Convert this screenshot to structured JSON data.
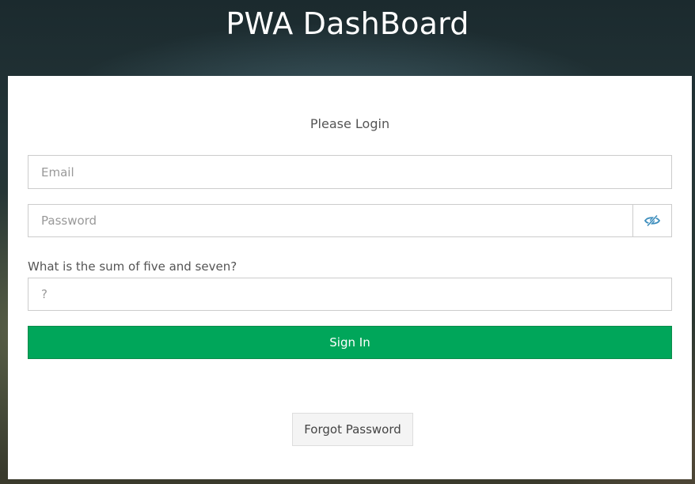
{
  "app": {
    "title": "PWA DashBoard"
  },
  "login": {
    "heading": "Please Login",
    "email": {
      "placeholder": "Email",
      "value": ""
    },
    "password": {
      "placeholder": "Password",
      "value": "",
      "toggle_icon": "eye-slash-icon"
    },
    "captcha": {
      "question": "What is the sum of five and seven?",
      "placeholder": "?",
      "value": ""
    },
    "signin_label": "Sign In",
    "forgot_label": "Forgot Password"
  },
  "colors": {
    "primary_action": "#00a65a",
    "icon_accent": "#3c8dbc",
    "panel_background": "#ffffff"
  }
}
